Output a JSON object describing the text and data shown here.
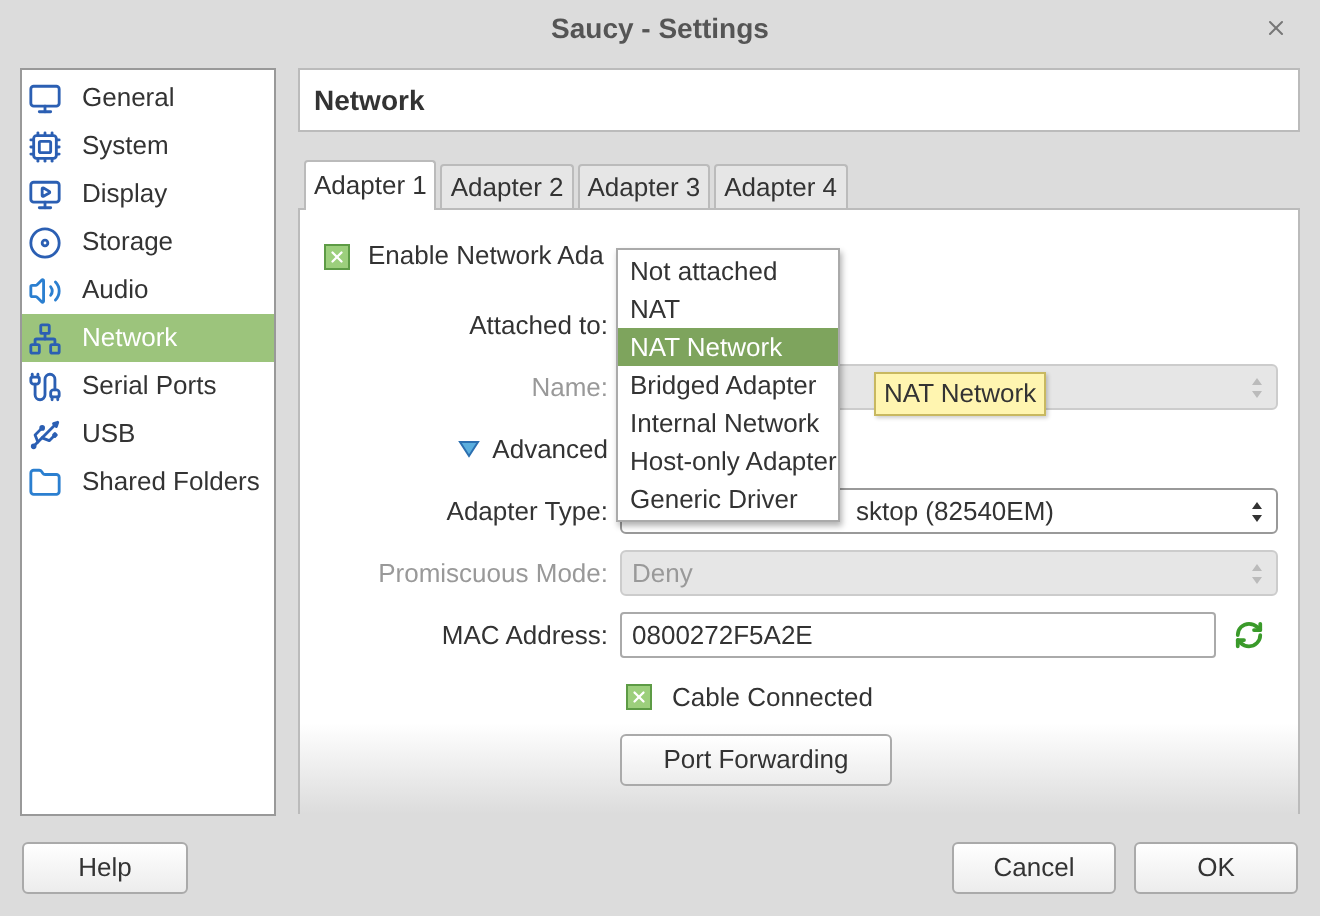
{
  "window": {
    "title": "Saucy - Settings"
  },
  "sidebar": {
    "items": [
      {
        "label": "General",
        "selected": false
      },
      {
        "label": "System",
        "selected": false
      },
      {
        "label": "Display",
        "selected": false
      },
      {
        "label": "Storage",
        "selected": false
      },
      {
        "label": "Audio",
        "selected": false
      },
      {
        "label": "Network",
        "selected": true
      },
      {
        "label": "Serial Ports",
        "selected": false
      },
      {
        "label": "USB",
        "selected": false
      },
      {
        "label": "Shared Folders",
        "selected": false
      }
    ]
  },
  "page_title": "Network",
  "tabs": [
    {
      "label": "Adapter 1",
      "selected": true
    },
    {
      "label": "Adapter 2",
      "selected": false
    },
    {
      "label": "Adapter 3",
      "selected": false
    },
    {
      "label": "Adapter 4",
      "selected": false
    }
  ],
  "enable_adapter": {
    "label": "Enable Network Ada",
    "checked": true
  },
  "attached_to": {
    "label": "Attached to:"
  },
  "name": {
    "label": "Name:",
    "disabled": true
  },
  "advanced": {
    "label": "Advanced",
    "expanded": true
  },
  "adapter_type": {
    "label": "Adapter Type:",
    "value": "sktop (82540EM)"
  },
  "promiscuous": {
    "label": "Promiscuous Mode:",
    "value": "Deny",
    "disabled": true
  },
  "mac": {
    "label": "MAC Address:",
    "value": "0800272F5A2E"
  },
  "cable": {
    "label": "Cable Connected",
    "checked": true
  },
  "port_forwarding": "Port Forwarding",
  "dropdown": {
    "options": [
      {
        "label": "Not attached",
        "selected": false
      },
      {
        "label": "NAT",
        "selected": false
      },
      {
        "label": "NAT Network",
        "selected": true
      },
      {
        "label": "Bridged Adapter",
        "selected": false
      },
      {
        "label": "Internal Network",
        "selected": false
      },
      {
        "label": "Host-only Adapter",
        "selected": false
      },
      {
        "label": "Generic Driver",
        "selected": false
      }
    ]
  },
  "tooltip": "NAT Network",
  "buttons": {
    "help": "Help",
    "cancel": "Cancel",
    "ok": "OK"
  }
}
